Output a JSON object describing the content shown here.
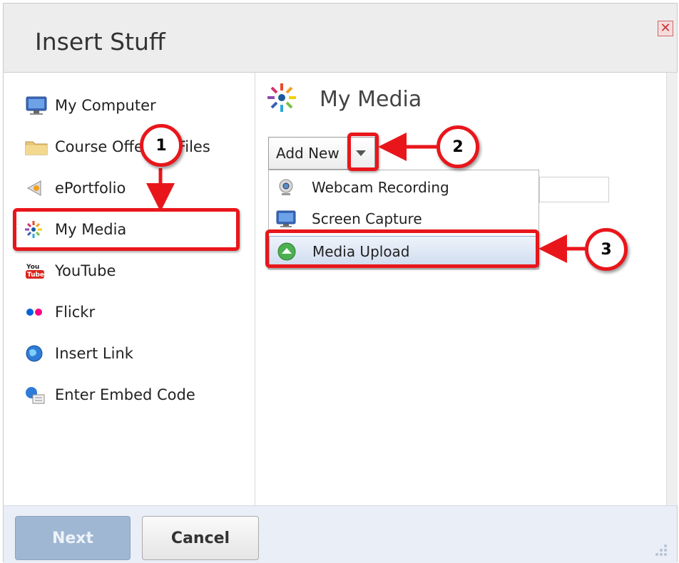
{
  "dialog": {
    "title": "Insert Stuff",
    "close_glyph": "✕"
  },
  "sidebar": {
    "items": [
      {
        "label": "My Computer",
        "icon": "monitor-icon"
      },
      {
        "label": "Course Offering Files",
        "icon": "folder-icon"
      },
      {
        "label": "ePortfolio",
        "icon": "eportfolio-icon"
      },
      {
        "label": "My Media",
        "icon": "kaltura-icon",
        "selected": true
      },
      {
        "label": "YouTube",
        "icon": "youtube-icon"
      },
      {
        "label": "Flickr",
        "icon": "flickr-icon"
      },
      {
        "label": "Insert Link",
        "icon": "globe-icon"
      },
      {
        "label": "Enter Embed Code",
        "icon": "embed-icon"
      }
    ]
  },
  "main": {
    "title": "My Media",
    "add_new_label": "Add New",
    "menu": [
      {
        "label": "Webcam Recording",
        "icon": "webcam-icon"
      },
      {
        "label": "Screen Capture",
        "icon": "monitor-icon"
      },
      {
        "label": "Media Upload",
        "icon": "upload-icon",
        "highlighted": true
      }
    ]
  },
  "footer": {
    "next_label": "Next",
    "cancel_label": "Cancel"
  },
  "annotations": {
    "badge1": "1",
    "badge2": "2",
    "badge3": "3",
    "color": "#e8161b"
  }
}
